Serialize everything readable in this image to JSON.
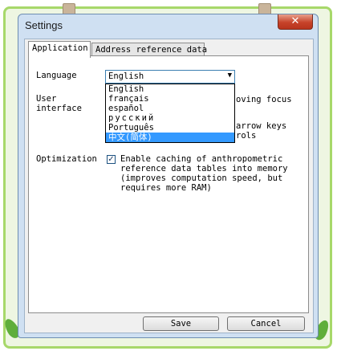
{
  "window": {
    "title": "Settings",
    "close_symbol": "✕"
  },
  "tabs": [
    {
      "label": "Application",
      "active": true
    },
    {
      "label": "Address reference data",
      "active": false
    }
  ],
  "language": {
    "label": "Language",
    "selected": "English",
    "options": [
      "English",
      "français",
      "español",
      "русский",
      "Português",
      "中文(简体)"
    ],
    "highlighted_index": 5
  },
  "user_interface": {
    "label_line1": "User",
    "label_line2": "interface",
    "visible_fragments": [
      "oving focus",
      "arrow keys",
      "rols"
    ]
  },
  "optimization": {
    "label": "Optimization",
    "checked": true,
    "text_lines": [
      "Enable caching of anthropometric",
      "reference data tables into memory",
      "(improves computation speed, but",
      "requires more RAM)"
    ]
  },
  "buttons": {
    "save": "Save",
    "cancel": "Cancel"
  },
  "colors": {
    "frame_green": "#a7d86a",
    "selection": "#3399ff",
    "close_red": "#c7432a"
  }
}
